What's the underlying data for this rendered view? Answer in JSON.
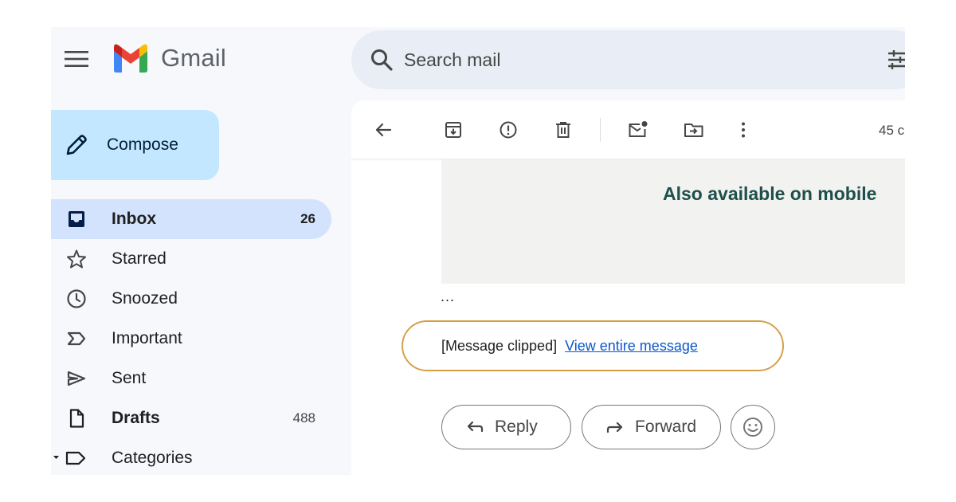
{
  "header": {
    "app_name": "Gmail",
    "search_placeholder": "Search mail"
  },
  "sidebar": {
    "compose_label": "Compose",
    "items": [
      {
        "label": "Inbox",
        "count": "26",
        "icon": "inbox-icon",
        "active": true,
        "bold": true
      },
      {
        "label": "Starred",
        "count": "",
        "icon": "star-icon"
      },
      {
        "label": "Snoozed",
        "count": "",
        "icon": "clock-icon"
      },
      {
        "label": "Important",
        "count": "",
        "icon": "important-icon"
      },
      {
        "label": "Sent",
        "count": "",
        "icon": "send-icon"
      },
      {
        "label": "Drafts",
        "count": "488",
        "icon": "file-icon",
        "bold": true
      },
      {
        "label": "Categories",
        "count": "",
        "icon": "label-icon"
      }
    ]
  },
  "toolbar": {
    "count_text": "45 c"
  },
  "message": {
    "promo_text": "Also available on mobile",
    "ellipsis": "...",
    "clipped_text": "[Message clipped]",
    "view_entire_link": "View entire message",
    "reply_label": "Reply",
    "forward_label": "Forward"
  },
  "colors": {
    "accent_blue": "#0b57d0",
    "compose_bg": "#c2e7ff",
    "active_nav_bg": "#d3e3fd",
    "highlight_border": "#d6a04a"
  }
}
